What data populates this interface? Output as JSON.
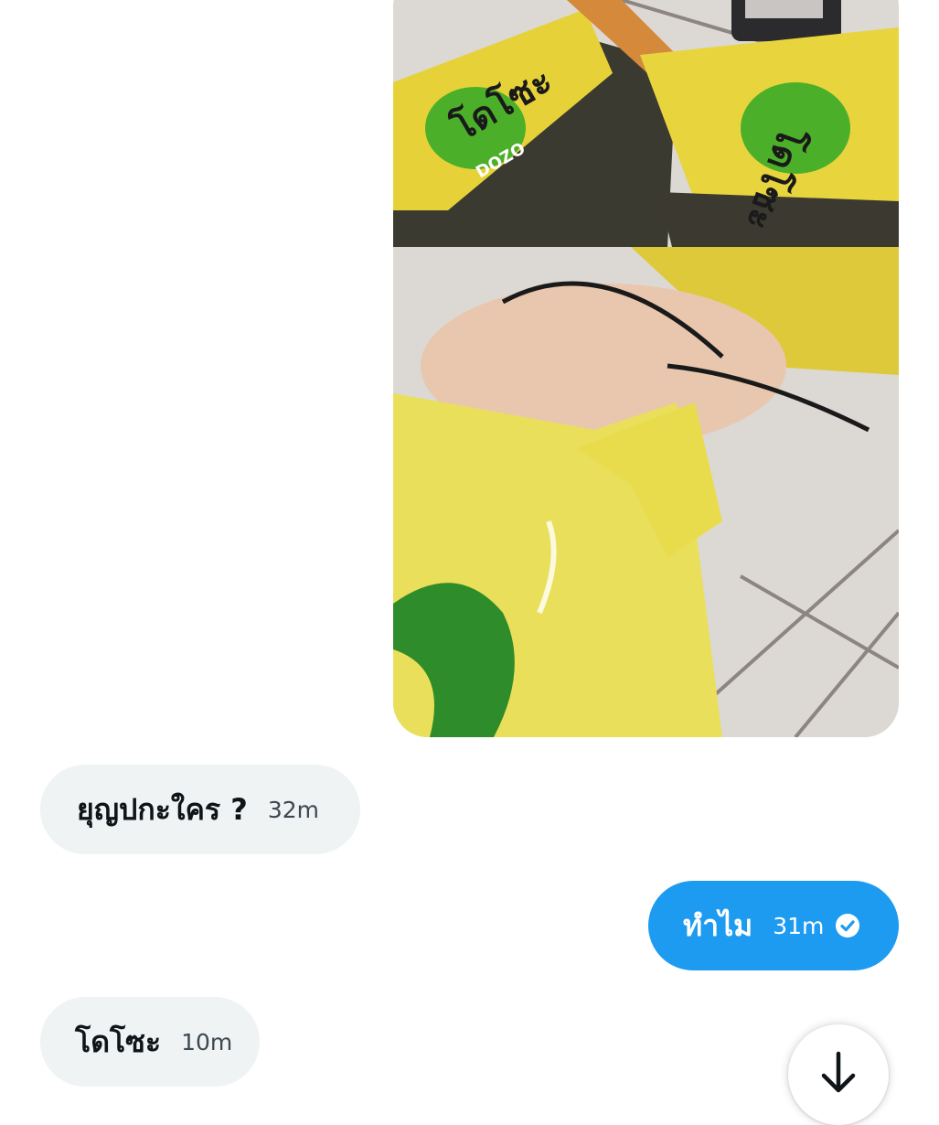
{
  "conversation": {
    "attachment": {
      "type": "photo",
      "package_brand_text": "โดโซะ",
      "package_brand_latin": "DOZO"
    },
    "messages": [
      {
        "direction": "received",
        "text": "ยุญปกะใคร ?",
        "time": "32m"
      },
      {
        "direction": "sent",
        "text": "ทำไม",
        "time": "31m",
        "status_icon": "check-circle-icon"
      },
      {
        "direction": "received",
        "text": "โดโซะ",
        "time": "10m"
      }
    ]
  },
  "controls": {
    "scroll_to_bottom_icon": "arrow-down-icon"
  },
  "colors": {
    "sent_bubble": "#1d9bf0",
    "received_bubble": "#eff3f4",
    "text_primary": "#0f1419"
  }
}
